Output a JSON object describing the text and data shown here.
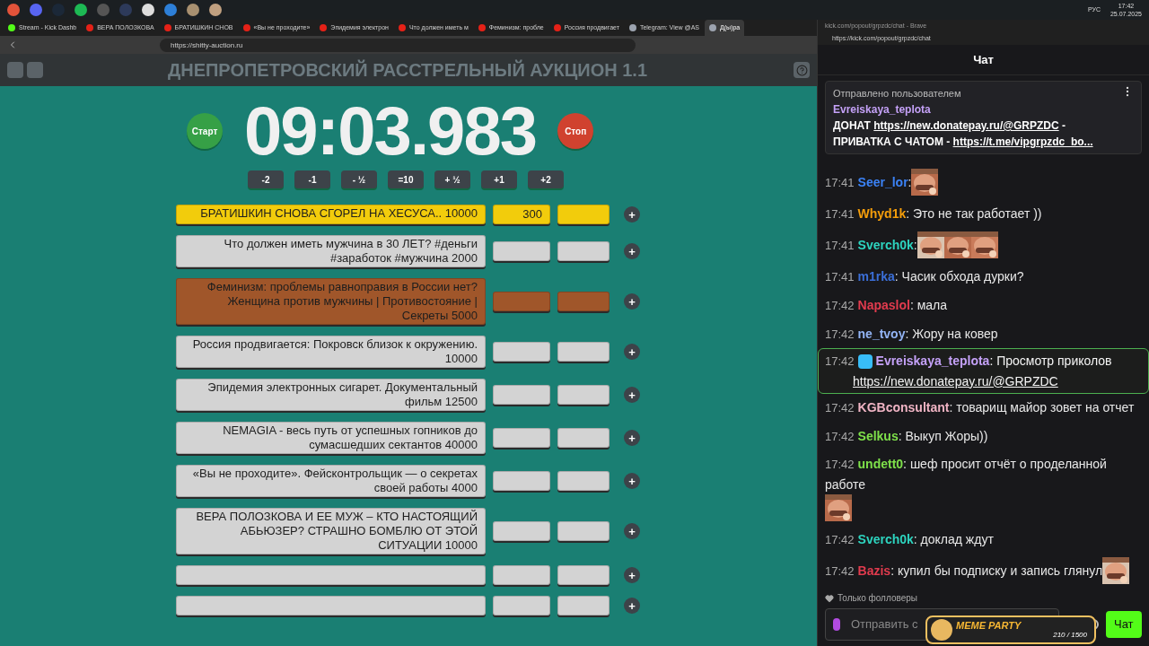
{
  "taskbar": {
    "tray": {
      "language": "РУС",
      "time": "17:42",
      "date": "25.07.2025"
    }
  },
  "browser": {
    "tabs": [
      {
        "title": "Stream - Kick Dashb",
        "selected": false,
        "kind": "kick"
      },
      {
        "title": "ВЕРА ПОЛОЗКОВА",
        "selected": false,
        "kind": "youtube"
      },
      {
        "title": "БРАТИШКИН СНОВ",
        "selected": false,
        "kind": "youtube"
      },
      {
        "title": "«Вы не проходите»",
        "selected": false,
        "kind": "youtube"
      },
      {
        "title": "Эпидемия электрон",
        "selected": false,
        "kind": "youtube"
      },
      {
        "title": "Что должен иметь м",
        "selected": false,
        "kind": "youtube"
      },
      {
        "title": "Феминизм: пробле",
        "selected": false,
        "kind": "youtube"
      },
      {
        "title": "Россия продвигает",
        "selected": false,
        "kind": "youtube"
      },
      {
        "title": "Telegram: View @AS",
        "selected": false,
        "kind": "web"
      },
      {
        "title": "Д(ы)ра",
        "selected": true,
        "kind": "web"
      }
    ],
    "url": "https://shitty-auction.ru"
  },
  "auction": {
    "title": "ДНЕПРОПЕТРОВСКИЙ РАССТРЕЛЬНЫЙ АУКЦИОН 1.1",
    "start": "Старт",
    "stop": "Стоп",
    "timer": "09:03.983",
    "adjust": [
      "-2",
      "-1",
      "- ½",
      "=10",
      "+ ½",
      "+1",
      "+2"
    ],
    "add": "+",
    "lots": [
      {
        "name": "БРАТИШКИН СНОВА СГОРЕЛ НА ХЕСУСА.. 10000",
        "amount": "300",
        "color": "#f2cc0c"
      },
      {
        "name": "Что должен иметь мужчина в 30 ЛЕТ? #деньги #заработок #мужчина 2000",
        "color": "#d3d3d3"
      },
      {
        "name": "Феминизм: проблемы равноправия в России нет? Женщина против мужчины | Противостояние | Секреты 5000",
        "color": "#a0562a"
      },
      {
        "name": "Россия продвигается: Покровск близок к окружению. 10000",
        "color": "#d3d3d3"
      },
      {
        "name": "Эпидемия электронных сигарет. Документальный фильм 12500",
        "color": "#d3d3d3"
      },
      {
        "name": "NEMAGIA - весь путь от успешных гопников до сумасшедших сектантов 40000",
        "color": "#d3d3d3"
      },
      {
        "name": "«Вы не проходите». Фейсконтрольщик — о секретах своей работы 4000",
        "color": "#d3d3d3"
      },
      {
        "name": "ВЕРА ПОЛОЗКОВА И ЕЕ МУЖ – КТО НАСТОЯЩИЙ АБЬЮЗЕР? СТРАШНО БОМБЛЮ ОТ ЭТОЙ СИТУАЦИИ 10000",
        "color": "#d3d3d3"
      },
      {
        "color": "#d3d3d3"
      },
      {
        "color": "#d3d3d3"
      }
    ]
  },
  "chat": {
    "window_title": "kick.com/popout/grpzdc/chat - Brave",
    "url": "https://kick.com/popout/grpzdc/chat",
    "header": "Чат",
    "pinned": {
      "label": "Отправлено пользователем",
      "user": "Evreiskaya_teplota",
      "text": "ДОНАТ ",
      "link": "https://new.donatepay.ru/@GRPZDC",
      "text2": " - ПРИВАТКА С ЧАТОМ - ",
      "link2": "https://t.me/vipgrpzdc_bo..."
    },
    "messages": [
      {
        "time": "17:41",
        "user": "Seer_lor",
        "color": "#3b82f6",
        "highlighted": false
      },
      {
        "time": "17:41",
        "user": "Whyd1k",
        "color": "#f59e0b",
        "text": "Это не так работает ))",
        "highlighted": false
      },
      {
        "time": "17:41",
        "user": "Sverch0k",
        "color": "#2dd4bf",
        "highlighted": false
      },
      {
        "time": "17:41",
        "user": "m1rka",
        "color": "#3b6fd8",
        "text": "Часик обхода дурки?",
        "highlighted": false
      },
      {
        "time": "17:42",
        "user": "Napaslol",
        "color": "#e23b4e",
        "text": "мала",
        "highlighted": false
      },
      {
        "time": "17:42",
        "user": "ne_tvoy",
        "color": "#93b4f5",
        "text": "Жору на ковер",
        "highlighted": false
      },
      {
        "time": "17:42",
        "user": "Evreiskaya_teplota",
        "color": "#c4a1f7",
        "text": "Просмотр приколов",
        "link": "https://new.donatepay.ru/@GRPZDC",
        "highlighted": true
      },
      {
        "time": "17:42",
        "user": "KGBconsultant",
        "color": "#f0b4c4",
        "text": "товарищ майор зовет на отчет",
        "highlighted": false
      },
      {
        "time": "17:42",
        "user": "Selkus",
        "color": "#7ee04a",
        "text": "Выкуп Жоры))",
        "highlighted": false
      },
      {
        "time": "17:42",
        "user": "undett0",
        "color": "#7ee04a",
        "text": "шеф просит отчёт о проделанной работе",
        "highlighted": false
      },
      {
        "time": "17:42",
        "user": "Sverch0k",
        "color": "#2dd4bf",
        "text": "доклад ждут",
        "highlighted": false
      },
      {
        "time": "17:42",
        "user": "Bazis",
        "color": "#e23b4e",
        "text": "купил бы подписку и запись глянул",
        "highlighted": false
      }
    ],
    "separator": ":",
    "followers_only": "Только фолловеры",
    "placeholder": "Отправить с",
    "send": "Чат"
  },
  "overlay": {
    "title": "MEME PARTY",
    "progress": "210 / 1500"
  }
}
